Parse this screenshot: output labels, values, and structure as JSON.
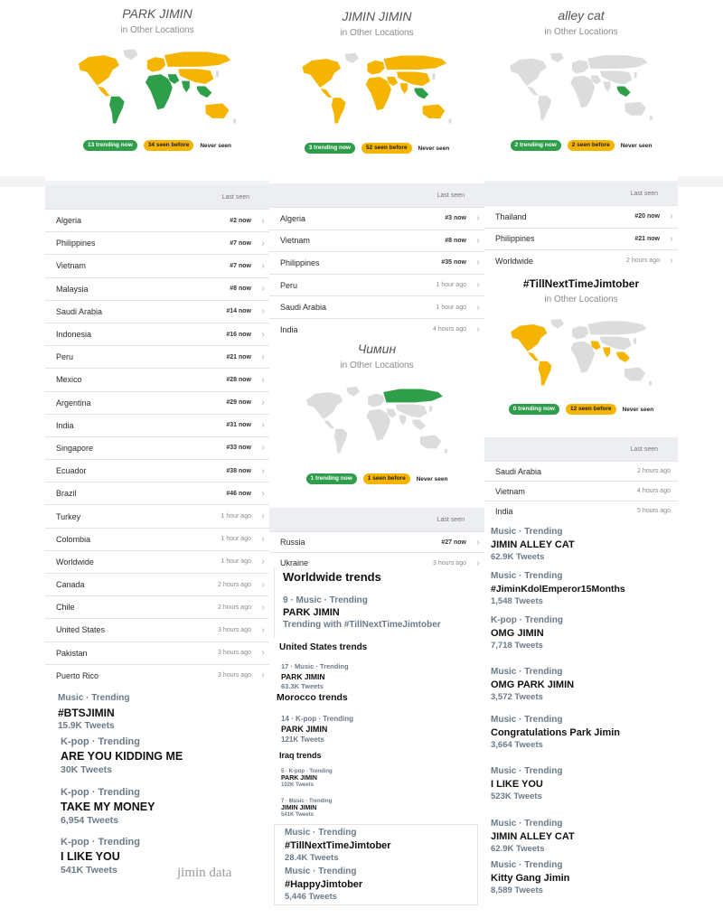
{
  "map1": {
    "title": "PARK JIMIN",
    "subtitle": "in Other Locations",
    "trending": "13 trending now",
    "seen": "34 seen before",
    "never": "Never seen"
  },
  "map2": {
    "title": "JIMIN JIMIN",
    "subtitle": "in Other Locations",
    "trending": "3 trending now",
    "seen": "52 seen before",
    "never": "Never seen"
  },
  "map3": {
    "title": "alley cat",
    "subtitle": "in Other Locations",
    "trending": "2 trending now",
    "seen": "2 seen before",
    "never": "Never seen"
  },
  "map4": {
    "title": "Чимин",
    "subtitle": "in Other Locations",
    "trending": "1 trending now",
    "seen": "1 seen before",
    "never": "Never seen"
  },
  "map5": {
    "title": "#TillNextTimeJimtober",
    "subtitle": "in Other Locations",
    "trending": "0 trending now",
    "seen": "12 seen before",
    "never": "Never seen"
  },
  "colors": {
    "trending": "#2e9e4b",
    "seen": "#f4b400",
    "never": "#dcdcdc"
  },
  "table1": {
    "header": "Last seen",
    "rows": [
      {
        "country": "Algeria",
        "status": "#2 now"
      },
      {
        "country": "Philippines",
        "status": "#7 now"
      },
      {
        "country": "Vietnam",
        "status": "#7 now"
      },
      {
        "country": "Malaysia",
        "status": "#8 now"
      },
      {
        "country": "Saudi Arabia",
        "status": "#14 now"
      },
      {
        "country": "Indonesia",
        "status": "#16 now"
      },
      {
        "country": "Peru",
        "status": "#21 now"
      },
      {
        "country": "Mexico",
        "status": "#28 now"
      },
      {
        "country": "Argentina",
        "status": "#29 now"
      },
      {
        "country": "India",
        "status": "#31 now"
      },
      {
        "country": "Singapore",
        "status": "#33 now"
      },
      {
        "country": "Ecuador",
        "status": "#38 now"
      },
      {
        "country": "Brazil",
        "status": "#46 now"
      },
      {
        "country": "Turkey",
        "status": "1 hour ago"
      },
      {
        "country": "Colombia",
        "status": "1 hour ago"
      },
      {
        "country": "Worldwide",
        "status": "1 hour ago"
      },
      {
        "country": "Canada",
        "status": "2 hours ago"
      },
      {
        "country": "Chile",
        "status": "2 hours ago"
      },
      {
        "country": "United States",
        "status": "3 hours ago"
      },
      {
        "country": "Pakistan",
        "status": "3 hours ago"
      },
      {
        "country": "Puerto Rico",
        "status": "3 hours ago"
      }
    ]
  },
  "table2": {
    "header": "Last seen",
    "rows": [
      {
        "country": "Algeria",
        "status": "#3 now"
      },
      {
        "country": "Vietnam",
        "status": "#8 now"
      },
      {
        "country": "Philippines",
        "status": "#35 now"
      },
      {
        "country": "Peru",
        "status": "1 hour ago"
      },
      {
        "country": "Saudi Arabia",
        "status": "1 hour ago"
      },
      {
        "country": "India",
        "status": "4 hours ago"
      }
    ]
  },
  "table3": {
    "header": "Last seen",
    "rows": [
      {
        "country": "Thailand",
        "status": "#20 now"
      },
      {
        "country": "Philippines",
        "status": "#21 now"
      },
      {
        "country": "Worldwide",
        "status": "2 hours ago"
      }
    ]
  },
  "table4": {
    "header": "Last seen",
    "rows": [
      {
        "country": "Russia",
        "status": "#27 now"
      },
      {
        "country": "Ukraine",
        "status": "3 hours ago"
      }
    ]
  },
  "table5": {
    "header": "Last seen",
    "rows": [
      {
        "country": "Saudi Arabia",
        "status": "2 hours ago"
      },
      {
        "country": "Vietnam",
        "status": "4 hours ago"
      },
      {
        "country": "India",
        "status": "5 hours ago"
      }
    ]
  },
  "trends_left": [
    {
      "category": "Music · Trending",
      "name": "#BTSJIMIN",
      "count": "15.9K Tweets"
    },
    {
      "category": "K-pop · Trending",
      "name": "ARE YOU KIDDING ME",
      "count": "30K Tweets"
    },
    {
      "category": "K-pop · Trending",
      "name": "TAKE MY MONEY",
      "count": "6,954 Tweets"
    },
    {
      "category": "K-pop · Trending",
      "name": "I LIKE YOU",
      "count": "541K Tweets"
    }
  ],
  "worldwide": {
    "header": "Worldwide trends",
    "category": "9 · Music · Trending",
    "name": "PARK JIMIN",
    "with": "Trending with #TillNextTimeJimtober"
  },
  "us": {
    "header": "United States trends",
    "category": "17 · Music · Trending",
    "name": "PARK JIMIN",
    "count": "63.3K Tweets"
  },
  "morocco": {
    "header": "Morocco trends",
    "category": "14 · K-pop · Trending",
    "name": "PARK JIMIN",
    "count": "121K Tweets"
  },
  "iraq": {
    "header": "Iraq trends",
    "items": [
      {
        "category": "5 · K-pop · Trending",
        "name": "PARK JIMIN",
        "count": "102K Tweets"
      },
      {
        "category": "7 · Music · Trending",
        "name": "JIMIN JIMIN",
        "count": "541K Tweets"
      }
    ]
  },
  "trends_middle": [
    {
      "category": "Music · Trending",
      "name": "#TillNextTimeJimtober",
      "count": "28.4K Tweets"
    },
    {
      "category": "Music · Trending",
      "name": "#HappyJimtober",
      "count": "5,446 Tweets"
    }
  ],
  "trends_right": [
    {
      "category": "Music · Trending",
      "name": "JIMIN ALLEY CAT",
      "count": "62.9K Tweets"
    },
    {
      "category": "Music · Trending",
      "name": "#JiminKdolEmperor15Months",
      "count": "1,548 Tweets"
    },
    {
      "category": "K-pop · Trending",
      "name": "OMG JIMIN",
      "count": "7,718 Tweets"
    },
    {
      "category": "Music · Trending",
      "name": "OMG PARK JIMIN",
      "count": "3,572 Tweets"
    },
    {
      "category": "Music · Trending",
      "name": "Congratulations Park Jimin",
      "count": "3,664 Tweets"
    },
    {
      "category": "Music · Trending",
      "name": "I LIKE YOU",
      "count": "523K Tweets"
    },
    {
      "category": "Music · Trending",
      "name": "JIMIN ALLEY CAT",
      "count": "62.9K Tweets"
    },
    {
      "category": "Music · Trending",
      "name": "Kitty Gang Jimin",
      "count": "8,589 Tweets"
    }
  ],
  "watermark": "jimin data"
}
